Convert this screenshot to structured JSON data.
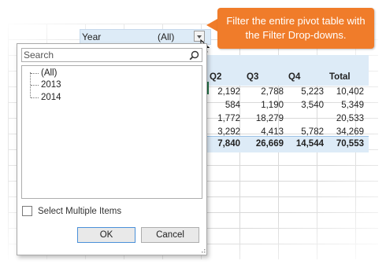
{
  "callout": {
    "text": "Filter the entire pivot table with the Filter Drop-downs."
  },
  "filter": {
    "label": "Year",
    "value": "(All)"
  },
  "search": {
    "placeholder": "Search"
  },
  "tree": {
    "items": [
      "(All)",
      "2013",
      "2014"
    ]
  },
  "multi_select_label": "Select Multiple Items",
  "buttons": {
    "ok": "OK",
    "cancel": "Cancel"
  },
  "pivot": {
    "headers": [
      "Q2",
      "Q3",
      "Q4",
      "Total"
    ],
    "rows": [
      [
        "2,192",
        "2,788",
        "5,223",
        "10,402"
      ],
      [
        "584",
        "1,190",
        "3,540",
        "5,349"
      ],
      [
        "1,772",
        "18,279",
        "",
        "20,533"
      ],
      [
        "3,292",
        "4,413",
        "5,782",
        "34,269"
      ]
    ],
    "totals": [
      "7,840",
      "26,669",
      "14,544",
      "70,553"
    ]
  },
  "colors": {
    "accent": "#f07c2a",
    "header_fill": "#ddebf7",
    "ok_border": "#4a90d9"
  }
}
